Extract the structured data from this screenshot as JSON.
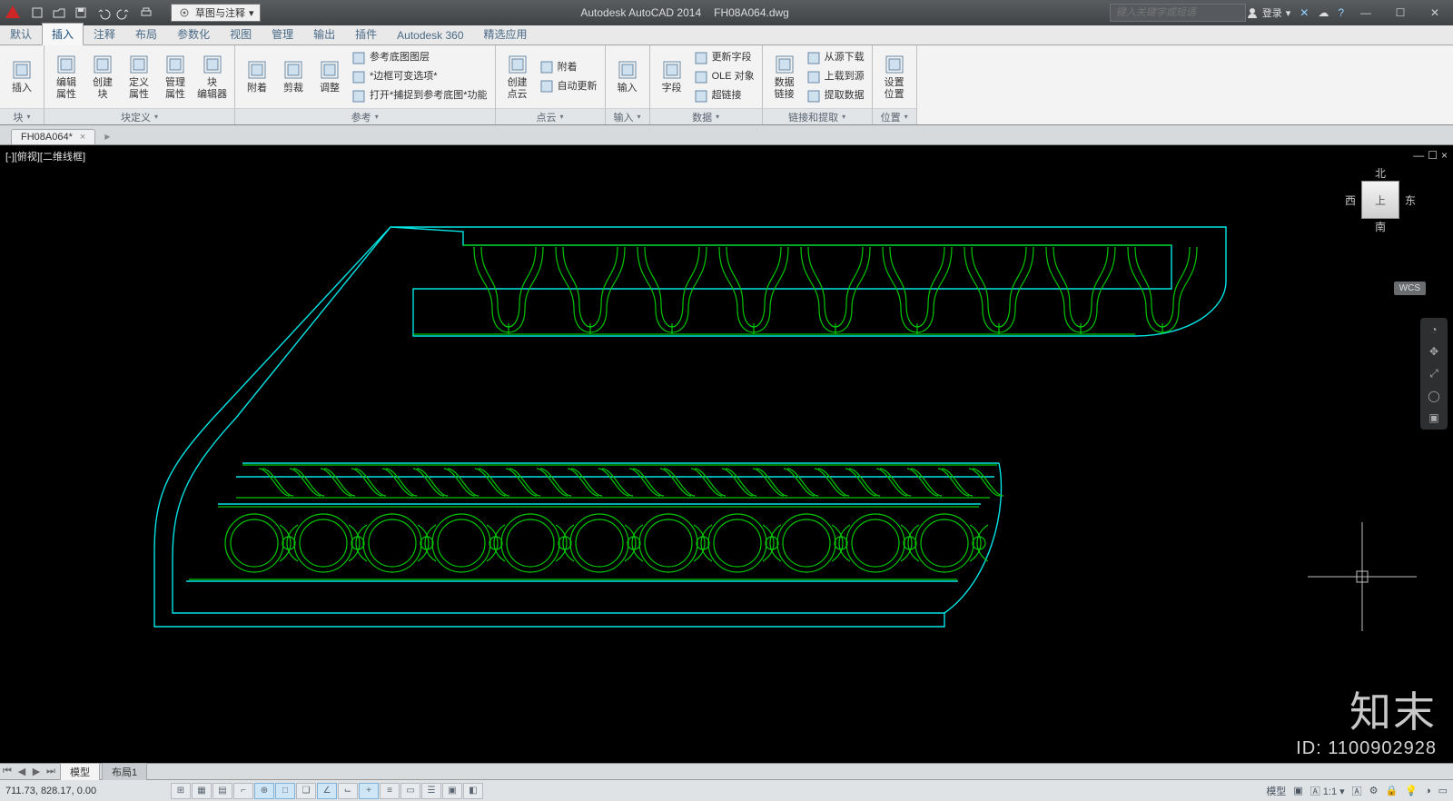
{
  "title": {
    "app": "Autodesk AutoCAD 2014",
    "file": "FH08A064.dwg"
  },
  "qat": {
    "workspace_label": "草图与注释"
  },
  "search_placeholder": "键入关键字或短语",
  "login_label": "登录",
  "menu_tabs": [
    "默认",
    "插入",
    "注释",
    "布局",
    "参数化",
    "视图",
    "管理",
    "输出",
    "插件",
    "Autodesk 360",
    "精选应用"
  ],
  "menu_active_index": 1,
  "ribbon": {
    "groups": [
      {
        "label": "块",
        "buttons": [
          {
            "t": "插入"
          }
        ]
      },
      {
        "label": "块定义",
        "buttons": [
          {
            "t": "编辑\n属性"
          },
          {
            "t": "创建\n块"
          },
          {
            "t": "定义\n属性"
          },
          {
            "t": "管理\n属性"
          },
          {
            "t": "块\n编辑器"
          }
        ]
      },
      {
        "label": "参考",
        "buttons": [
          {
            "t": "附着"
          },
          {
            "t": "剪裁"
          },
          {
            "t": "调整"
          }
        ],
        "side": [
          "参考底图图层",
          "*边框可变选项*",
          "打开*捕捉到参考底图*功能"
        ]
      },
      {
        "label": "点云",
        "buttons": [
          {
            "t": "创建\n点云"
          }
        ],
        "side": [
          "附着",
          "自动更新"
        ]
      },
      {
        "label": "输入",
        "buttons": [
          {
            "t": "输入"
          }
        ]
      },
      {
        "label": "数据",
        "buttons": [
          {
            "t": "字段"
          }
        ],
        "side": [
          "更新字段",
          "OLE 对象",
          "超链接"
        ]
      },
      {
        "label": "链接和提取",
        "buttons": [
          {
            "t": "数据\n链接"
          }
        ],
        "side": [
          "从源下载",
          "上载到源",
          "提取数据"
        ]
      },
      {
        "label": "位置",
        "buttons": [
          {
            "t": "设置\n位置"
          }
        ]
      }
    ]
  },
  "file_tab": {
    "name": "FH08A064*"
  },
  "view_label": "[-][俯视][二维线框]",
  "viewcube": {
    "n": "北",
    "s": "南",
    "e": "东",
    "w": "西",
    "top": "上"
  },
  "wcs": "WCS",
  "layout_tabs": [
    "模型",
    "布局1"
  ],
  "status": {
    "coords": "711.73, 828.17, 0.00",
    "right_mode": "模型",
    "scale": "1:1"
  },
  "watermark": {
    "brand": "知末",
    "id_label": "ID: 1100902928"
  }
}
